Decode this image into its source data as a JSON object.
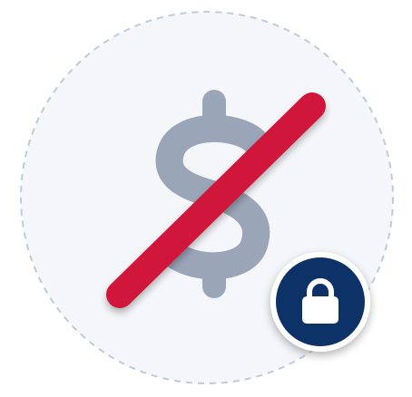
{
  "illustration": {
    "icons": {
      "circle": "dashed-circle",
      "currency": "dollar-sign-icon",
      "slash": "prohibition-slash-icon",
      "badge": "lock-badge",
      "lock": "lock-icon"
    },
    "colors": {
      "page_background": "#ffffff",
      "circle_fill": "#f4f6f9",
      "circle_border": "#bfcbd9",
      "dollar": "#9aa5b7",
      "slash": "#d0193a",
      "badge_fill": "#0b3068",
      "badge_ring": "#ffffff",
      "lock": "#ffffff"
    }
  }
}
